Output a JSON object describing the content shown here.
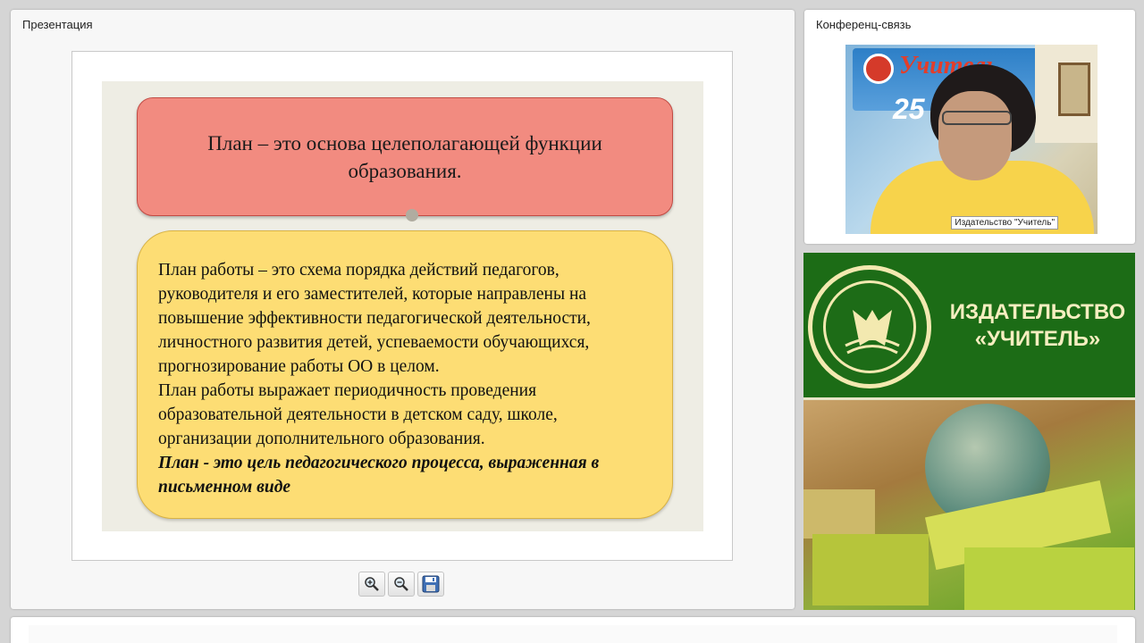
{
  "presentation_panel": {
    "title": "Презентация",
    "slide": {
      "heading_box": "План – это основа целеполагающей функции образования.",
      "body_paragraphs": [
        "План работы – это схема порядка действий педагогов, руководителя и его заместителей, которые направлены на повышение эффективности педагогической деятельности, личностного развития детей, успеваемости обучающихся, прогнозирование работы  ОО в целом.",
        "План работы выражает периодичность проведения образовательной деятельности в детском саду, школе, организации дополнительного образования."
      ],
      "emphasis": "План - это цель педагогического процесса, выраженная в письменном виде"
    },
    "toolbar": {
      "zoom_in_icon": "zoom-in-icon",
      "zoom_out_icon": "zoom-out-icon",
      "save_icon": "floppy-disk-icon"
    }
  },
  "conference_panel": {
    "title": "Конференц-связь",
    "video": {
      "banner_text": "Учитель",
      "banner_number": "25",
      "caption": "Издательство \"Учитель\""
    }
  },
  "ad_panel": {
    "title_line1": "ИЗДАТЕЛЬСТВО",
    "title_line2": "«УЧИТЕЛЬ»"
  },
  "colors": {
    "heading_box": "#f28b80",
    "body_box": "#fddd74",
    "ad_green": "#1c6c16",
    "ad_text": "#f6eec0"
  }
}
